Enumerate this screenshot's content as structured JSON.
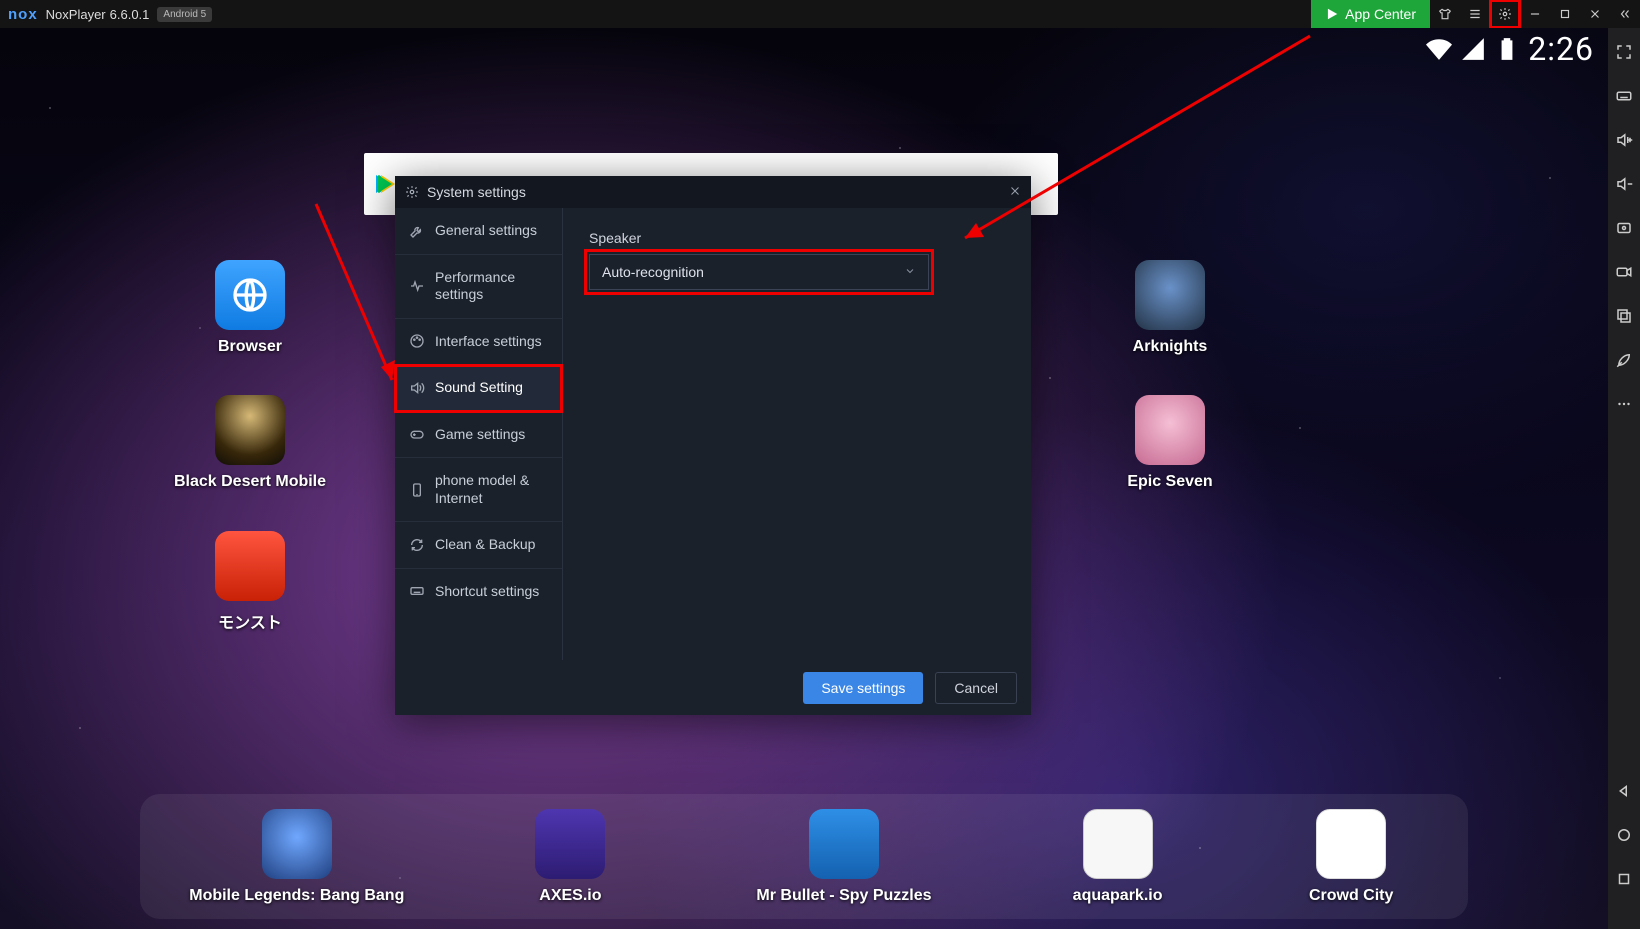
{
  "titlebar": {
    "product": "NoxPlayer",
    "version": "6.6.0.1",
    "android_badge": "Android 5",
    "app_center": "App Center"
  },
  "status": {
    "clock": "2:26"
  },
  "desktop": {
    "browser": "Browser",
    "blackdesert": "Black Desert Mobile",
    "monsuto": "モンスト",
    "arknights": "Arknights",
    "epicseven": "Epic Seven"
  },
  "dock": {
    "mlbb": "Mobile Legends: Bang Bang",
    "axes": "AXES.io",
    "mrbullet": "Mr Bullet - Spy Puzzles",
    "aquapark": "aquapark.io",
    "crowdcity": "Crowd City"
  },
  "dialog": {
    "title": "System settings",
    "nav": {
      "general": "General settings",
      "performance": "Performance settings",
      "interface": "Interface settings",
      "sound": "Sound Setting",
      "game": "Game settings",
      "phone": "phone model & Internet",
      "clean": "Clean & Backup",
      "shortcut": "Shortcut settings"
    },
    "speaker_label": "Speaker",
    "speaker_value": "Auto-recognition",
    "save": "Save settings",
    "cancel": "Cancel"
  }
}
